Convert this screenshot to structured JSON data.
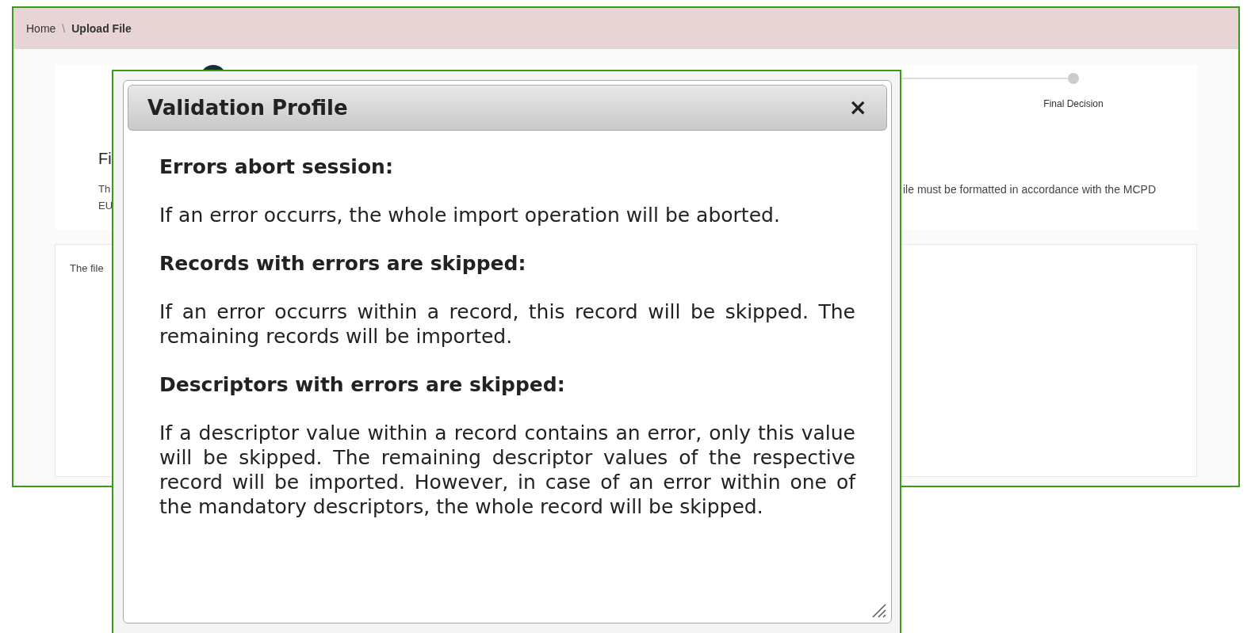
{
  "breadcrumb_separator": "\\",
  "breadcrumb": [
    {
      "label": "Home",
      "current": false
    },
    {
      "label": "Upload File",
      "current": true
    }
  ],
  "stepper": {
    "steps": [
      {
        "label": "Final Decision",
        "done": false
      }
    ]
  },
  "intro": {
    "heading_fragment": "Fi",
    "text_fragment_1": "Th",
    "text_fragment_2": "EU",
    "text_fragment_right": "ile must be formatted in accordance with the MCPD"
  },
  "upload_panel": {
    "text_fragment": "The file"
  },
  "dialog": {
    "title": "Validation Profile",
    "close": "×",
    "sections": [
      {
        "heading": "Errors abort session:",
        "text": "If an error occurrs, the whole import operation will be aborted."
      },
      {
        "heading": "Records with errors are skipped:",
        "text": "If an error occurrs within a record, this record will be skipped. The remaining records will be imported."
      },
      {
        "heading": "Descriptors with errors are skipped:",
        "text": "If a descriptor value within a record contains an error, only this value will be skipped. The remaining descriptor values of the respective record will be imported. However, in case of an error within one of the mandatory descriptors, the whole record will be skipped."
      }
    ]
  }
}
